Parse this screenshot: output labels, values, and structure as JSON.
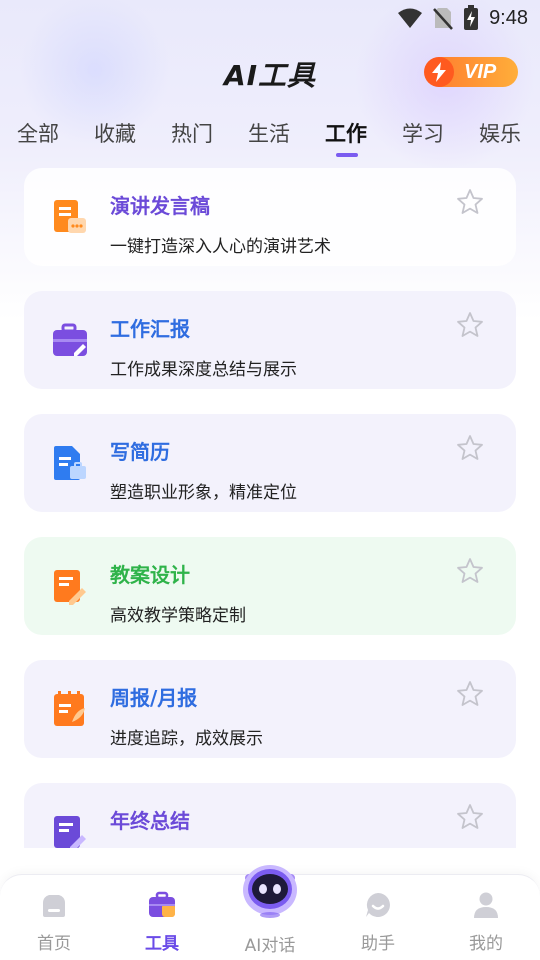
{
  "status_bar": {
    "time": "9:48",
    "icons": [
      "wifi-icon",
      "no-sim-icon",
      "battery-charging-icon"
    ]
  },
  "header": {
    "title": "AI工具",
    "vip_label": "VIP"
  },
  "tabs": [
    {
      "label": "全部",
      "active": false
    },
    {
      "label": "收藏",
      "active": false
    },
    {
      "label": "热门",
      "active": false
    },
    {
      "label": "生活",
      "active": false
    },
    {
      "label": "工作",
      "active": true
    },
    {
      "label": "学习",
      "active": false
    },
    {
      "label": "娱乐",
      "active": false
    }
  ],
  "cards": [
    {
      "title": "演讲发言稿",
      "desc": "一键打造深入人心的演讲艺术",
      "title_color": "#6b4ad8",
      "icon": "speech-document-icon"
    },
    {
      "title": "工作汇报",
      "desc": "工作成果深度总结与展示",
      "title_color": "#2f6de0",
      "icon": "briefcase-edit-icon"
    },
    {
      "title": "写简历",
      "desc": "塑造职业形象，精准定位",
      "title_color": "#2f6de0",
      "icon": "resume-document-icon"
    },
    {
      "title": "教案设计",
      "desc": "高效教学策略定制",
      "title_color": "#2fb34a",
      "icon": "lesson-plan-icon"
    },
    {
      "title": "周报/月报",
      "desc": "进度追踪，成效展示",
      "title_color": "#2f6de0",
      "icon": "report-icon"
    },
    {
      "title": "年终总结",
      "desc": "",
      "title_color": "#6b4ad8",
      "icon": "summary-document-icon"
    }
  ],
  "bottom_nav": [
    {
      "label": "首页",
      "icon": "home-icon",
      "active": false
    },
    {
      "label": "工具",
      "icon": "toolbox-icon",
      "active": true
    },
    {
      "label": "AI对话",
      "icon": "robot-icon",
      "active": false
    },
    {
      "label": "助手",
      "icon": "chat-bubble-icon",
      "active": false
    },
    {
      "label": "我的",
      "icon": "user-icon",
      "active": false
    }
  ],
  "colors": {
    "accent": "#6a4be8",
    "vip_gradient_start": "#ff7a2e",
    "vip_gradient_end": "#ffae3a"
  }
}
